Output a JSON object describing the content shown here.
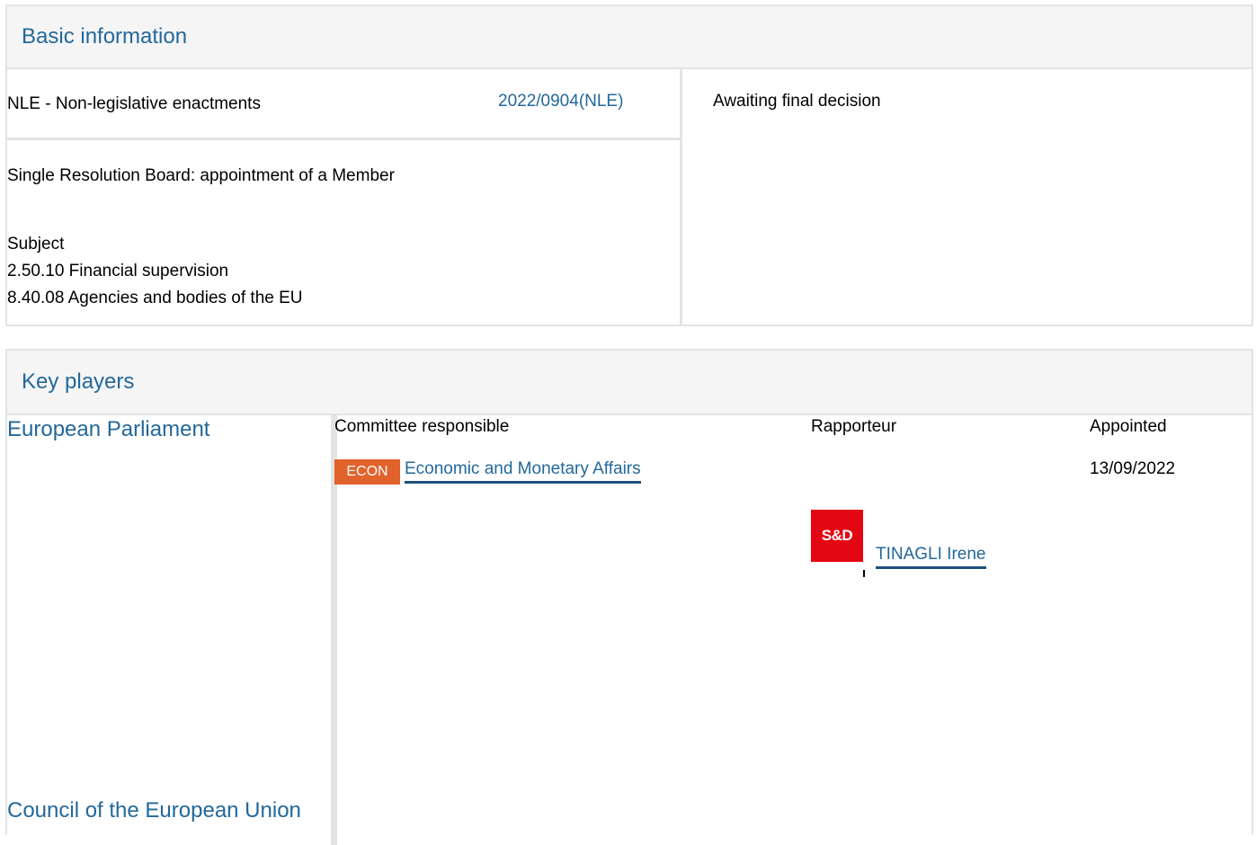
{
  "basic": {
    "title": "Basic information",
    "procedure_type": "NLE - Non-legislative enactments",
    "procedure_ref": "2022/0904(NLE)",
    "status": "Awaiting final decision",
    "procedure_title": "Single Resolution Board: appointment of a Member",
    "subject_label": "Subject",
    "subjects": [
      "2.50.10 Financial supervision",
      "8.40.08 Agencies and bodies of the EU"
    ]
  },
  "players": {
    "title": "Key players",
    "parliament_label": "European Parliament",
    "council_label": "Council of the European Union",
    "col_committee": "Committee responsible",
    "col_rapporteur": "Rapporteur",
    "col_appointed": "Appointed",
    "committee_code": "ECON",
    "committee_name": "Economic and Monetary Affairs",
    "appointed_date": "13/09/2022",
    "group_logo_text": "S&D",
    "rapporteur_name": "TINAGLI Irene"
  },
  "colors": {
    "link": "#23689b",
    "econ_badge": "#e1622b",
    "sd_logo": "#e30613",
    "border": "#e3e3e3"
  }
}
